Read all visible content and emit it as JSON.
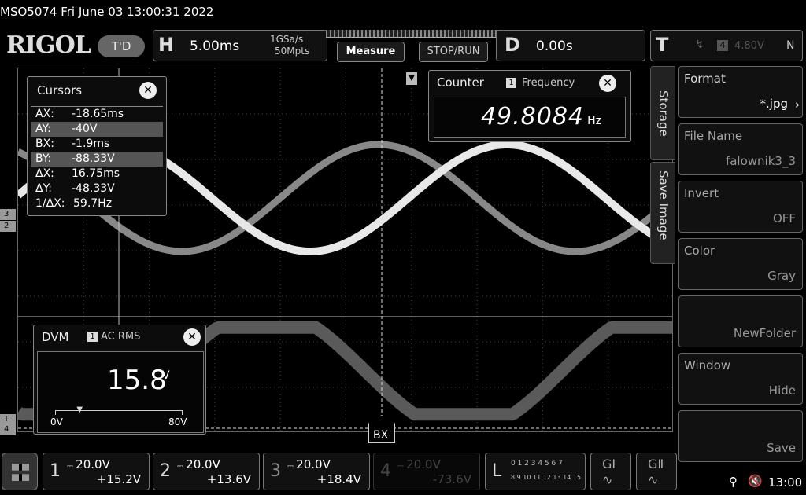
{
  "title_line": "MSO5074  Fri June 03 13:00:31 2022",
  "brand": "RIGOL",
  "mode_badge": "T'D",
  "horizontal": {
    "letter": "H",
    "timebase": "5.00ms",
    "sample_rate": "1GSa/s",
    "memory_depth": "50Mpts"
  },
  "buttons": {
    "measure": "Measure",
    "stop_run": "STOP/RUN"
  },
  "delay": {
    "letter": "D",
    "value": "0.00s"
  },
  "trigger": {
    "letter": "T",
    "source": "4",
    "level": "4.80V",
    "mode": "N"
  },
  "cursors": {
    "title": "Cursors",
    "rows": [
      {
        "key": "AX:",
        "value": "-18.65ms"
      },
      {
        "key": "AY:",
        "value": "-40V"
      },
      {
        "key": "BX:",
        "value": "-1.9ms"
      },
      {
        "key": "BY:",
        "value": "-88.33V"
      },
      {
        "key": "ΔX:",
        "value": "16.75ms"
      },
      {
        "key": "ΔY:",
        "value": "-48.33V"
      },
      {
        "key": "1/ΔX:",
        "value": "59.7Hz"
      }
    ]
  },
  "counter": {
    "title": "Counter",
    "channel": "1",
    "label": "Frequency",
    "value": "49.8084",
    "unit": "Hz"
  },
  "dvm": {
    "title": "DVM",
    "channel": "1",
    "mode": "AC RMS",
    "value": "15.8",
    "unit": "V",
    "scale_min": "0V",
    "scale_max": "80V",
    "level_fraction": 0.2
  },
  "bx_label": "BX",
  "ax_label": "AX",
  "side_tabs": {
    "storage": "Storage",
    "save_image": "Save Image"
  },
  "side_menu": [
    {
      "label": "Format",
      "value": "*.jpg"
    },
    {
      "label": "File Name",
      "value": "falownik3_3"
    },
    {
      "label": "Invert",
      "value": "OFF"
    },
    {
      "label": "Color",
      "value": "Gray"
    },
    {
      "label": "",
      "value": "NewFolder"
    },
    {
      "label": "Window",
      "value": "Hide"
    },
    {
      "label": "",
      "value": "Save"
    }
  ],
  "channels": [
    {
      "num": "1",
      "scale": "20.0V",
      "offset": "+15.2V"
    },
    {
      "num": "2",
      "scale": "20.0V",
      "offset": "+13.6V"
    },
    {
      "num": "3",
      "scale": "20.0V",
      "offset": "+18.4V"
    },
    {
      "num": "4",
      "scale": "20.0V",
      "offset": "-73.6V"
    }
  ],
  "logic": {
    "letter": "L",
    "row1": "0 1 2 3  4 5 6 7",
    "row2": "8 9 10 11 12 13 14 15"
  },
  "bus": {
    "g1": "GⅠ",
    "g2": "GⅡ"
  },
  "status": {
    "time": "13:00"
  },
  "channel_markers": [
    "3",
    "2",
    "T",
    "4"
  ],
  "colors": {
    "trace_bright": "#e8e8e8",
    "trace_mid": "#888888",
    "trace_dim": "#5a5a5a"
  }
}
